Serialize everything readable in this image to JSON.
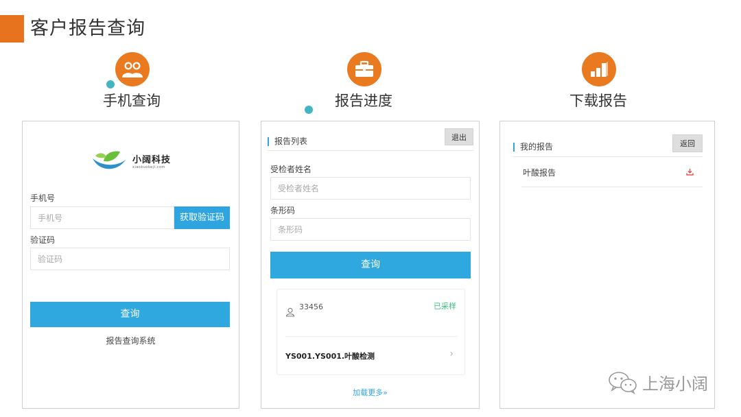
{
  "header": {
    "title": "客户报告查询",
    "accent_color": "#e8731e"
  },
  "columns": [
    {
      "label": "手机查询",
      "icon": "users-icon"
    },
    {
      "label": "报告进度",
      "icon": "briefcase-icon"
    },
    {
      "label": "下载报告",
      "icon": "bar-chart-icon"
    }
  ],
  "phone_panel": {
    "logo_text": "小阔科技",
    "logo_sub": "xiaokuokeji.com",
    "phone_label": "手机号",
    "phone_placeholder": "手机号",
    "get_code_label": "获取验证码",
    "code_label": "验证码",
    "code_placeholder": "验证码",
    "query_label": "查询",
    "system_label": "报告查询系统"
  },
  "progress_panel": {
    "section_title": "报告列表",
    "logout_label": "退出",
    "name_label": "受检者姓名",
    "name_placeholder": "受检者姓名",
    "barcode_label": "条形码",
    "barcode_placeholder": "条形码",
    "query_label": "查询",
    "card": {
      "id": "33456",
      "status": "已采样",
      "title": "YS001.YS001.叶酸检测"
    },
    "load_more": "加载更多»"
  },
  "download_panel": {
    "section_title": "我的报告",
    "back_label": "返回",
    "items": [
      {
        "label": "叶酸报告",
        "icon": "download-icon"
      }
    ]
  },
  "watermark": {
    "text": "上海小阔",
    "icon": "wechat-icon"
  }
}
